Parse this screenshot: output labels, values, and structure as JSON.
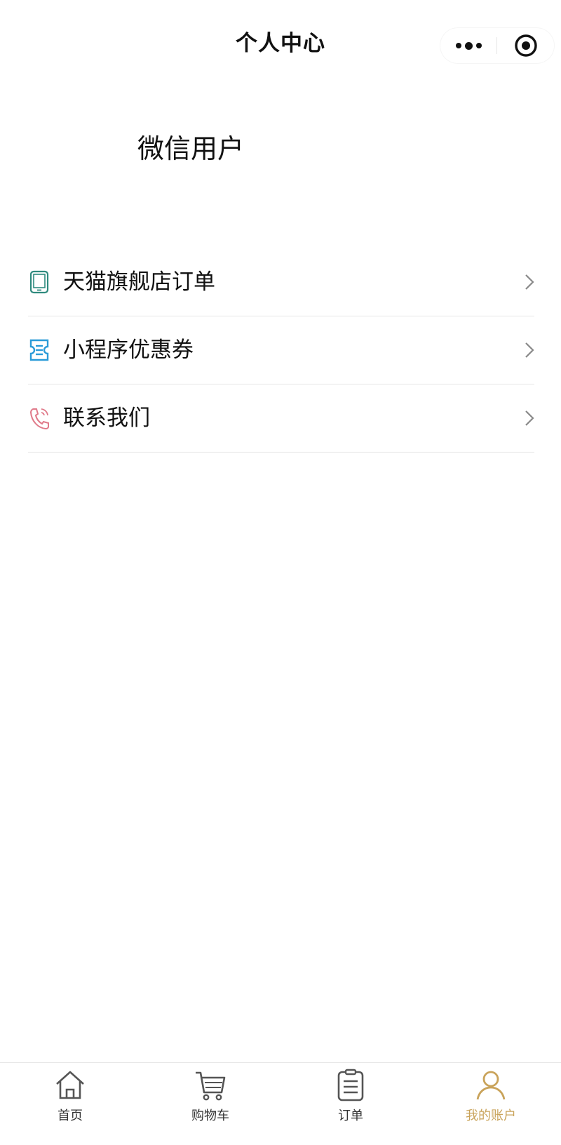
{
  "header": {
    "title": "个人中心",
    "more_icon": "more-dots-icon",
    "close_icon": "target-close-icon"
  },
  "user": {
    "name": "微信用户"
  },
  "menu": {
    "items": [
      {
        "label": "天猫旗舰店订单",
        "icon": "tablet-icon",
        "icon_color": "#2f8a7e"
      },
      {
        "label": "小程序优惠券",
        "icon": "coupon-icon",
        "icon_color": "#2a9bd8"
      },
      {
        "label": "联系我们",
        "icon": "phone-icon",
        "icon_color": "#e07a8a"
      }
    ]
  },
  "tabbar": {
    "tabs": [
      {
        "label": "首页",
        "icon": "home-icon"
      },
      {
        "label": "购物车",
        "icon": "cart-icon"
      },
      {
        "label": "订单",
        "icon": "clipboard-icon"
      },
      {
        "label": "我的账户",
        "icon": "user-icon",
        "active": true
      }
    ],
    "active_color": "#c9a35a",
    "inactive_color": "#555555"
  }
}
